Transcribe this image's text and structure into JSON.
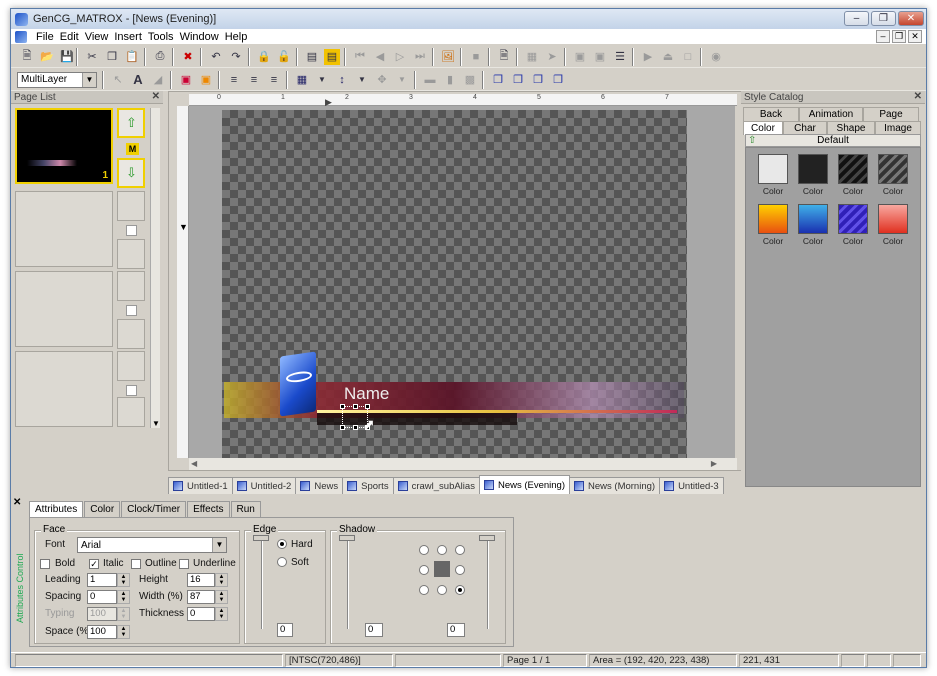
{
  "titlebar": {
    "title": "GenCG_MATROX - [News (Evening)]"
  },
  "menu": [
    "File",
    "Edit",
    "View",
    "Insert",
    "Tools",
    "Window",
    "Help"
  ],
  "toolbar2": {
    "layer_select": "MultiLayer"
  },
  "pagelist": {
    "title": "Page List",
    "page_number": "1",
    "marker": "M"
  },
  "stylecatalog": {
    "title": "Style Catalog",
    "tabs_row1": [
      "Back",
      "Animation",
      "Page"
    ],
    "tabs_row2": [
      "Color",
      "Char",
      "Shape",
      "Image"
    ],
    "default_label": "Default",
    "swatches": [
      {
        "label": "Color",
        "color": "#e8e8e8"
      },
      {
        "label": "Color",
        "color": "#222222"
      },
      {
        "label": "Color",
        "color": "#333333"
      },
      {
        "label": "Color",
        "color": "#444444"
      },
      {
        "label": "Color",
        "color": "#f07a10"
      },
      {
        "label": "Color",
        "color": "#2058c8"
      },
      {
        "label": "Color",
        "color": "#4030c0"
      },
      {
        "label": "Color",
        "color": "#e85040"
      }
    ]
  },
  "canvas": {
    "name_text": "Name",
    "ruler_marks": [
      "0",
      "1",
      "2",
      "3",
      "4",
      "5",
      "6",
      "7"
    ]
  },
  "doctabs": [
    "Untitled-1",
    "Untitled-2",
    "News",
    "Sports",
    "crawl_subAlias",
    "News (Evening)",
    "News (Morning)",
    "Untitled-3"
  ],
  "attributes": {
    "tabs": [
      "Attributes",
      "Color",
      "Clock/Timer",
      "Effects",
      "Run"
    ],
    "panel_title": "Attributes Control",
    "face": {
      "legend": "Face",
      "font_label": "Font",
      "font_value": "Arial",
      "bold": "Bold",
      "italic": "Italic",
      "outline": "Outline",
      "underline": "Underline",
      "leading_label": "Leading",
      "leading_value": "1",
      "height_label": "Height",
      "height_value": "16",
      "spacing_label": "Spacing",
      "spacing_value": "0",
      "width_label": "Width (%)",
      "width_value": "87",
      "typing_label": "Typing",
      "typing_value": "100",
      "thickness_label": "Thickness",
      "thickness_value": "0",
      "space_label": "Space (%)",
      "space_value": "100"
    },
    "edge": {
      "legend": "Edge",
      "hard": "Hard",
      "soft": "Soft",
      "value": "0"
    },
    "shadow": {
      "legend": "Shadow",
      "value1": "0",
      "value2": "0"
    }
  },
  "status": {
    "format": "[NTSC(720,486)]",
    "page": "Page 1 / 1",
    "area": "Area = (192, 420, 223, 438)",
    "coords": "221, 431"
  }
}
